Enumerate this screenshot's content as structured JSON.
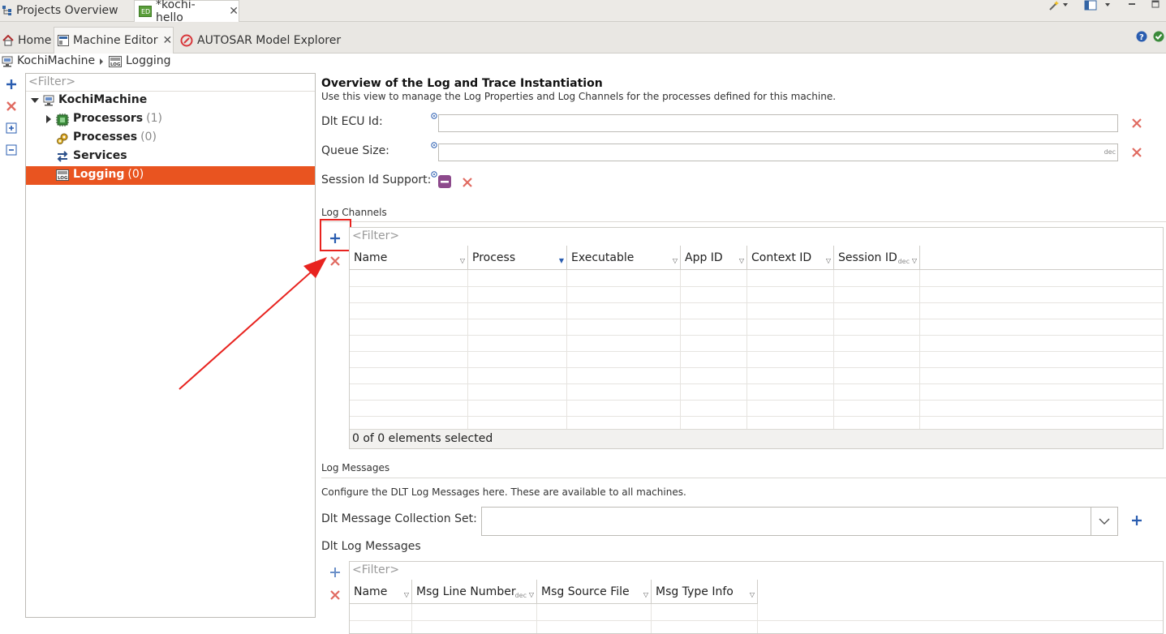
{
  "editor_tabs": [
    {
      "label": "Projects Overview",
      "icon": "project-tree-icon"
    },
    {
      "label": "*kochi-hello",
      "icon": "ed-file-icon"
    }
  ],
  "view_tabs": [
    {
      "label": "Home",
      "icon": "home-icon"
    },
    {
      "label": "Machine Editor",
      "icon": "machine-editor-icon"
    },
    {
      "label": "AUTOSAR Model Explorer",
      "icon": "autosar-icon"
    }
  ],
  "breadcrumb": {
    "root": "KochiMachine",
    "current": "Logging"
  },
  "tree": {
    "filter_placeholder": "<Filter>",
    "root": "KochiMachine",
    "items": [
      {
        "label": "Processors",
        "count": "(1)"
      },
      {
        "label": "Processes",
        "count": "(0)"
      },
      {
        "label": "Services",
        "count": ""
      },
      {
        "label": "Logging",
        "count": "(0)"
      }
    ]
  },
  "overview": {
    "title": "Overview of the Log and Trace Instantiation",
    "subtitle": "Use this view to manage the Log Properties and Log Channels for the processes defined for this machine.",
    "dlt_ecu_label": "Dlt ECU Id:",
    "dlt_ecu_value": "",
    "queue_label": "Queue Size:",
    "queue_value": "",
    "queue_unit": "dec",
    "session_label": "Session Id Support:"
  },
  "log_channels": {
    "section_title": "Log Channels",
    "filter_placeholder": "<Filter>",
    "columns": [
      "Name",
      "Process",
      "Executable",
      "App ID",
      "Context ID",
      "Session ID"
    ],
    "session_unit": "dec",
    "status": "0 of 0 elements selected"
  },
  "log_messages": {
    "section_title": "Log Messages",
    "description": "Configure the DLT Log Messages here. These are available to all machines.",
    "collection_label": "Dlt Message Collection Set:",
    "collection_value": "",
    "dlt_log_title": "Dlt Log Messages",
    "filter_placeholder": "<Filter>",
    "columns": [
      "Name",
      "Msg Line Number",
      "Msg Source File",
      "Msg Type Info"
    ],
    "line_unit": "dec"
  },
  "colors": {
    "selection": "#e95420",
    "annotation": "#e8231f",
    "accent": "#2a5db0"
  }
}
